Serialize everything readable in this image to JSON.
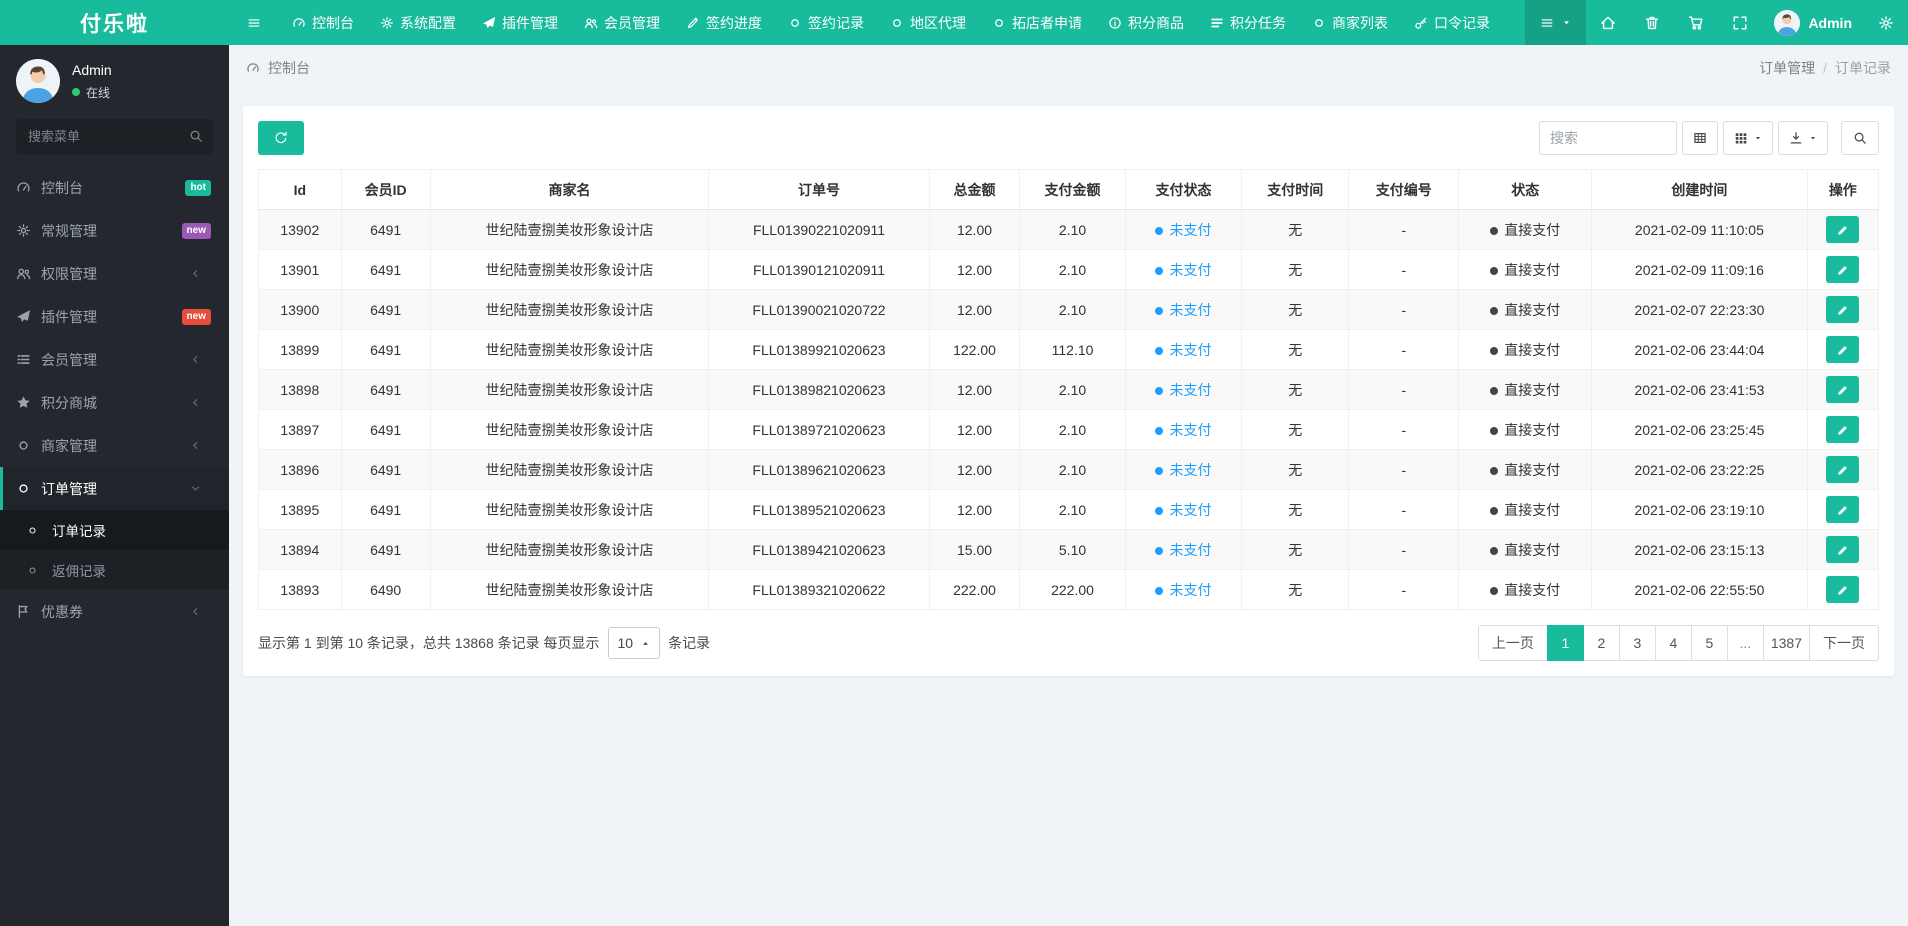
{
  "colors": {
    "accent": "#18bc9c",
    "sidebar_bg": "#24282e",
    "submenu_bg": "#1d2126",
    "sidebar_text": "#9aa4ad",
    "content_bg": "#f1f4f6",
    "blue": "#1e9fff",
    "badge_hot": "#18bc9c",
    "badge_new_purple": "#9b59b6",
    "badge_new_red": "#e74c3c",
    "online_green": "#2ecc71",
    "status_dark_dot": "#454545"
  },
  "navbar": {
    "logo": "付乐啦",
    "items": [
      {
        "key": "console",
        "icon": "gauge",
        "label": "控制台"
      },
      {
        "key": "system-config",
        "icon": "gear",
        "label": "系统配置"
      },
      {
        "key": "plugin",
        "icon": "plane",
        "label": "插件管理"
      },
      {
        "key": "member",
        "icon": "users",
        "label": "会员管理"
      },
      {
        "key": "sign-progress",
        "icon": "pen",
        "label": "签约进度"
      },
      {
        "key": "sign-record",
        "icon": "circle",
        "label": "签约记录"
      },
      {
        "key": "region-agent",
        "icon": "circle",
        "label": "地区代理"
      },
      {
        "key": "store-apply",
        "icon": "circle",
        "label": "拓店者申请"
      },
      {
        "key": "points-goods",
        "icon": "info",
        "label": "积分商品"
      },
      {
        "key": "points-task",
        "icon": "tasks",
        "label": "积分任务"
      },
      {
        "key": "merchant-list",
        "icon": "circle",
        "label": "商家列表"
      },
      {
        "key": "token-record",
        "icon": "key",
        "label": "口令记录"
      }
    ],
    "right_icons": [
      {
        "key": "home",
        "icon": "home"
      },
      {
        "key": "trash",
        "icon": "trash"
      },
      {
        "key": "cart",
        "icon": "cart"
      },
      {
        "key": "fullscreen",
        "icon": "expand"
      }
    ],
    "user": {
      "name": "Admin"
    }
  },
  "sidebar": {
    "user": {
      "name": "Admin",
      "status": "在线"
    },
    "search_placeholder": "搜索菜单",
    "menu": [
      {
        "key": "console",
        "icon": "gauge",
        "label": "控制台",
        "badge": "hot",
        "badge_color": "#18bc9c"
      },
      {
        "key": "general",
        "icon": "gear",
        "label": "常规管理",
        "badge": "new",
        "badge_color": "#9b59b6"
      },
      {
        "key": "permission",
        "icon": "users",
        "label": "权限管理",
        "chevron": true
      },
      {
        "key": "plugin",
        "icon": "plane",
        "label": "插件管理",
        "badge": "new",
        "badge_color": "#e74c3c"
      },
      {
        "key": "member",
        "icon": "list",
        "label": "会员管理",
        "chevron": true
      },
      {
        "key": "points-mall",
        "icon": "star",
        "label": "积分商城",
        "chevron": true
      },
      {
        "key": "merchant",
        "icon": "circle",
        "label": "商家管理",
        "chevron": true
      },
      {
        "key": "order",
        "icon": "circle",
        "label": "订单管理",
        "chevron": true,
        "expanded": true,
        "active": true,
        "children": [
          {
            "key": "order-record",
            "label": "订单记录",
            "active": true
          },
          {
            "key": "rebate-record",
            "label": "返佣记录"
          }
        ]
      },
      {
        "key": "coupon",
        "icon": "flag",
        "label": "优惠券",
        "chevron": true
      }
    ]
  },
  "breadcrumb": {
    "section": "控制台",
    "trail": [
      "订单管理",
      "订单记录"
    ]
  },
  "toolbar": {
    "search_placeholder": "搜索",
    "buttons": [
      {
        "key": "view-toggle",
        "icon": "table"
      },
      {
        "key": "columns",
        "icon": "columns",
        "caret": true
      },
      {
        "key": "export",
        "icon": "export",
        "caret": true
      }
    ]
  },
  "table": {
    "columns": [
      "Id",
      "会员ID",
      "商家名",
      "订单号",
      "总金额",
      "支付金额",
      "支付状态",
      "支付时间",
      "支付编号",
      "状态",
      "创建时间",
      "操作"
    ],
    "rows": [
      {
        "id": "13902",
        "member_id": "6491",
        "merchant": "世纪陆壹捌美妆形象设计店",
        "order_no": "FLL01390221020911",
        "total": "12.00",
        "paid": "2.10",
        "pay_status": "未支付",
        "pay_time": "无",
        "pay_no": "-",
        "status": "直接支付",
        "created": "2021-02-09 11:10:05"
      },
      {
        "id": "13901",
        "member_id": "6491",
        "merchant": "世纪陆壹捌美妆形象设计店",
        "order_no": "FLL01390121020911",
        "total": "12.00",
        "paid": "2.10",
        "pay_status": "未支付",
        "pay_time": "无",
        "pay_no": "-",
        "status": "直接支付",
        "created": "2021-02-09 11:09:16"
      },
      {
        "id": "13900",
        "member_id": "6491",
        "merchant": "世纪陆壹捌美妆形象设计店",
        "order_no": "FLL01390021020722",
        "total": "12.00",
        "paid": "2.10",
        "pay_status": "未支付",
        "pay_time": "无",
        "pay_no": "-",
        "status": "直接支付",
        "created": "2021-02-07 22:23:30"
      },
      {
        "id": "13899",
        "member_id": "6491",
        "merchant": "世纪陆壹捌美妆形象设计店",
        "order_no": "FLL01389921020623",
        "total": "122.00",
        "paid": "112.10",
        "pay_status": "未支付",
        "pay_time": "无",
        "pay_no": "-",
        "status": "直接支付",
        "created": "2021-02-06 23:44:04"
      },
      {
        "id": "13898",
        "member_id": "6491",
        "merchant": "世纪陆壹捌美妆形象设计店",
        "order_no": "FLL01389821020623",
        "total": "12.00",
        "paid": "2.10",
        "pay_status": "未支付",
        "pay_time": "无",
        "pay_no": "-",
        "status": "直接支付",
        "created": "2021-02-06 23:41:53"
      },
      {
        "id": "13897",
        "member_id": "6491",
        "merchant": "世纪陆壹捌美妆形象设计店",
        "order_no": "FLL01389721020623",
        "total": "12.00",
        "paid": "2.10",
        "pay_status": "未支付",
        "pay_time": "无",
        "pay_no": "-",
        "status": "直接支付",
        "created": "2021-02-06 23:25:45"
      },
      {
        "id": "13896",
        "member_id": "6491",
        "merchant": "世纪陆壹捌美妆形象设计店",
        "order_no": "FLL01389621020623",
        "total": "12.00",
        "paid": "2.10",
        "pay_status": "未支付",
        "pay_time": "无",
        "pay_no": "-",
        "status": "直接支付",
        "created": "2021-02-06 23:22:25"
      },
      {
        "id": "13895",
        "member_id": "6491",
        "merchant": "世纪陆壹捌美妆形象设计店",
        "order_no": "FLL01389521020623",
        "total": "12.00",
        "paid": "2.10",
        "pay_status": "未支付",
        "pay_time": "无",
        "pay_no": "-",
        "status": "直接支付",
        "created": "2021-02-06 23:19:10"
      },
      {
        "id": "13894",
        "member_id": "6491",
        "merchant": "世纪陆壹捌美妆形象设计店",
        "order_no": "FLL01389421020623",
        "total": "15.00",
        "paid": "5.10",
        "pay_status": "未支付",
        "pay_time": "无",
        "pay_no": "-",
        "status": "直接支付",
        "created": "2021-02-06 23:15:13"
      },
      {
        "id": "13893",
        "member_id": "6490",
        "merchant": "世纪陆壹捌美妆形象设计店",
        "order_no": "FLL01389321020622",
        "total": "222.00",
        "paid": "222.00",
        "pay_status": "未支付",
        "pay_time": "无",
        "pay_no": "-",
        "status": "直接支付",
        "created": "2021-02-06 22:55:50"
      }
    ]
  },
  "footer": {
    "summary_prefix": "显示第 1 到第 10 条记录，总共 13868 条记录 每页显示",
    "page_size": "10",
    "summary_suffix": "条记录"
  },
  "pagination": {
    "prev": "上一页",
    "next": "下一页",
    "pages": [
      "1",
      "2",
      "3",
      "4",
      "5",
      "...",
      "1387"
    ],
    "active": "1"
  }
}
